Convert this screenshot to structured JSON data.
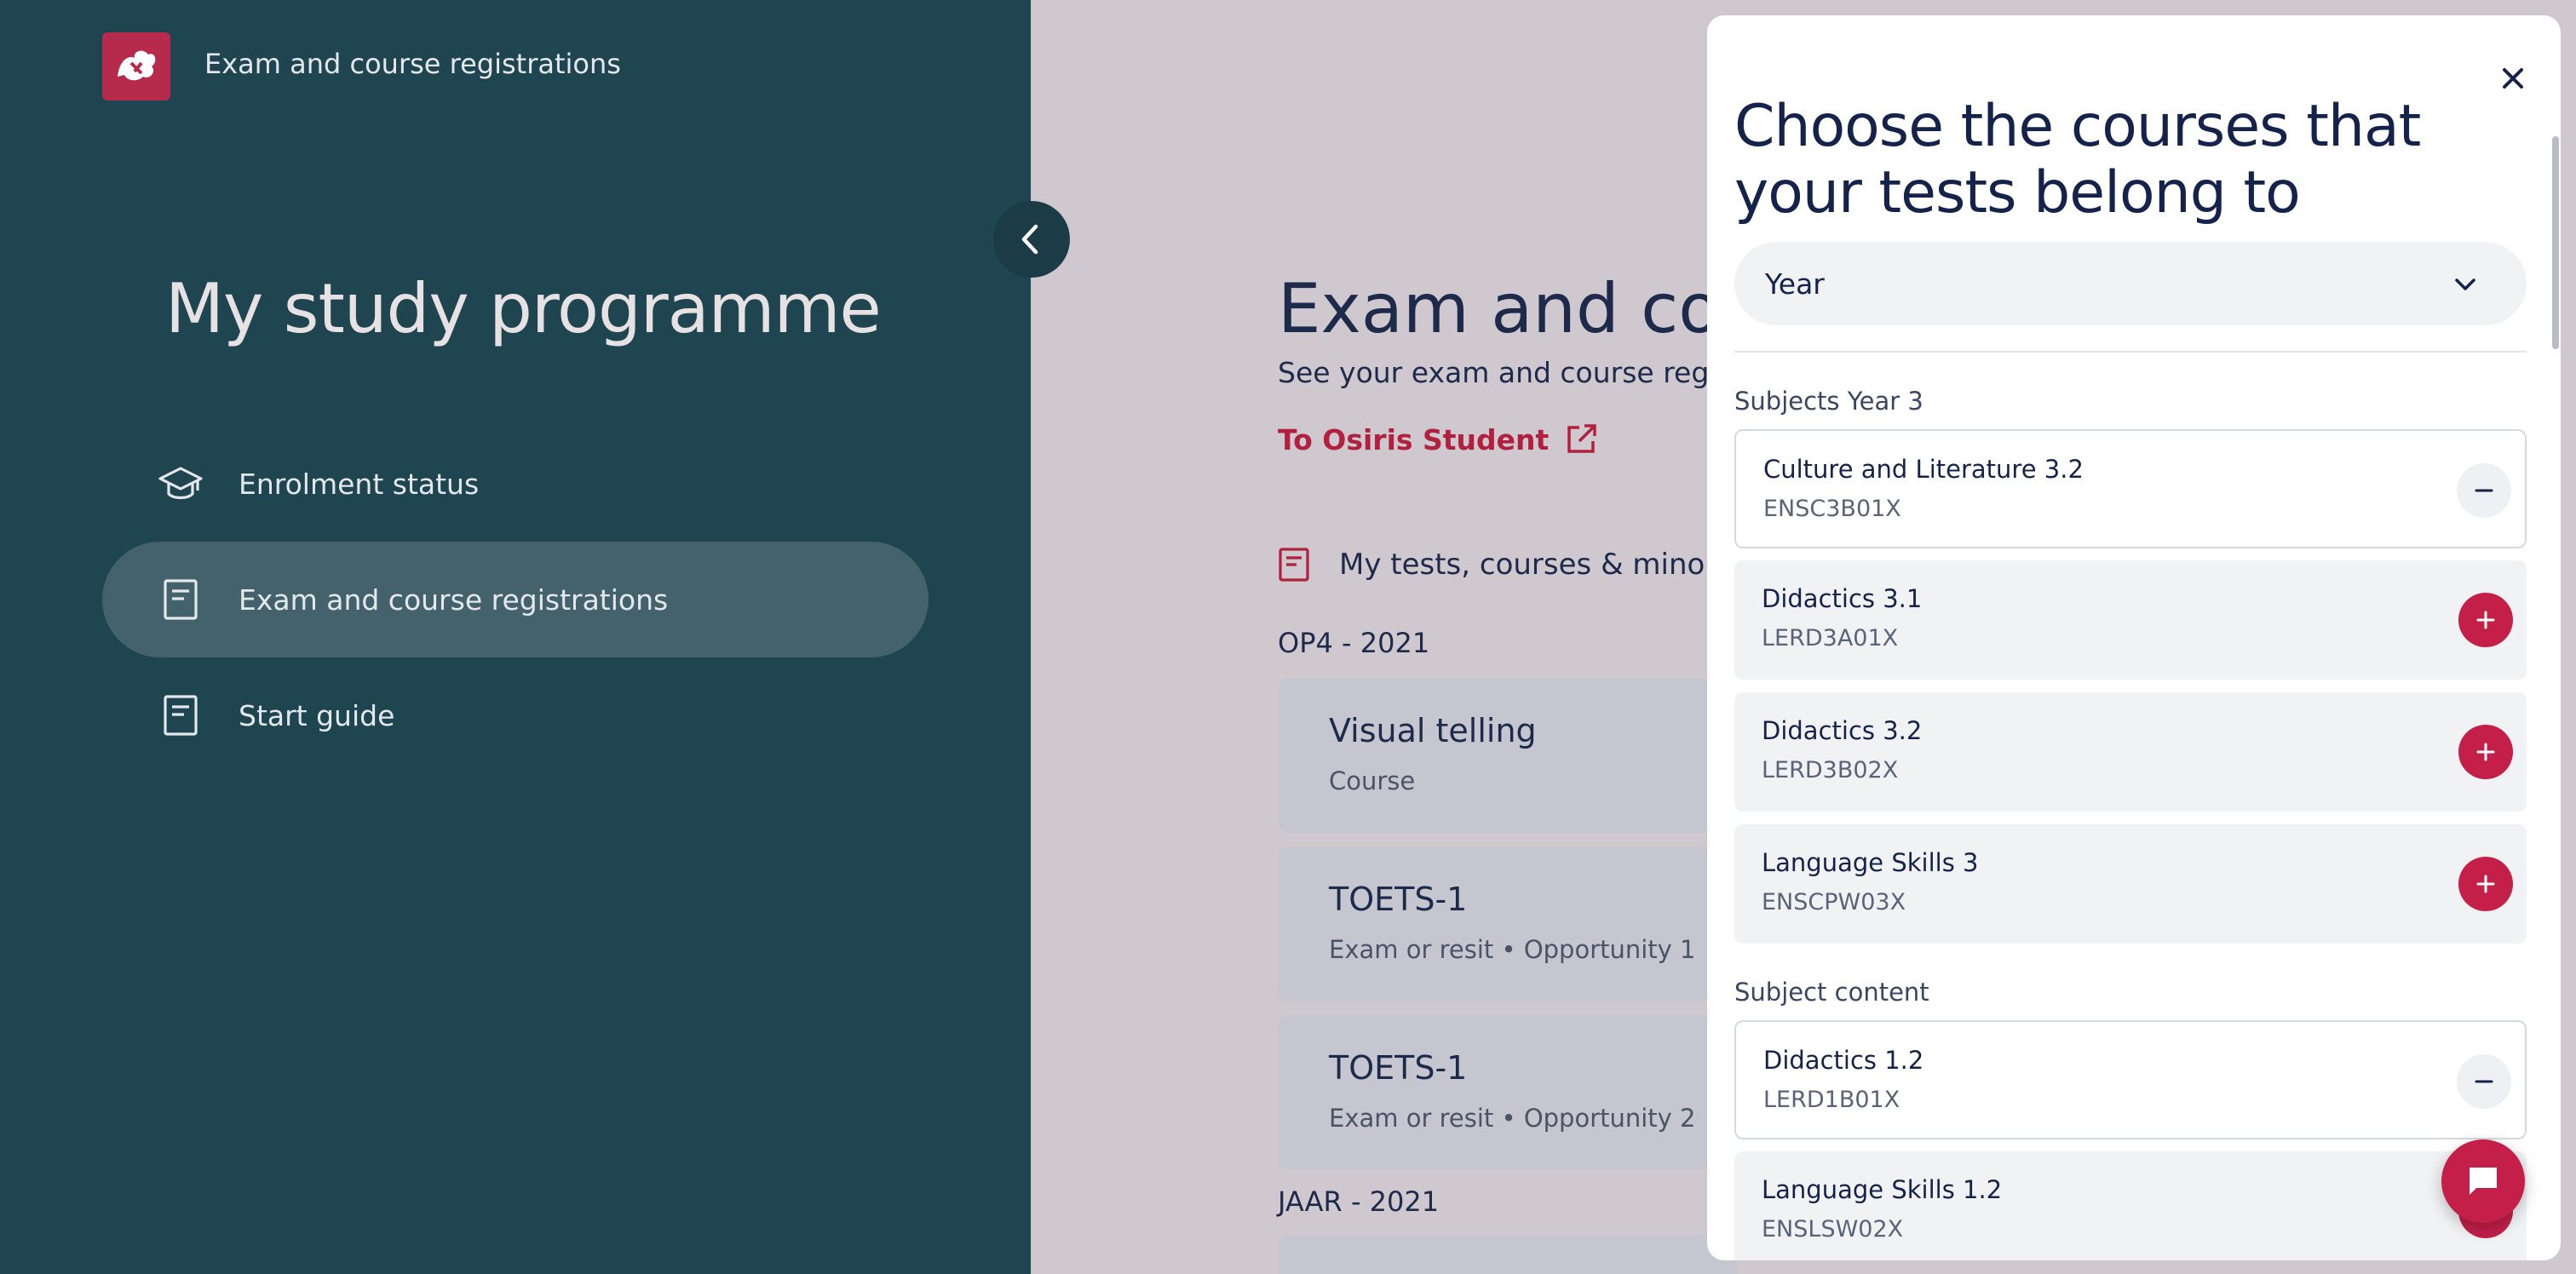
{
  "app": {
    "title": "Exam and course registrations"
  },
  "sidebar": {
    "heading": "My study programme",
    "items": [
      {
        "label": "Enrolment status",
        "icon": "graduation-cap-icon",
        "active": false
      },
      {
        "label": "Exam and course registrations",
        "icon": "document-icon",
        "active": true
      },
      {
        "label": "Start guide",
        "icon": "document-icon",
        "active": false
      }
    ]
  },
  "main": {
    "heading": "Exam and course registrations",
    "subtitle": "See your exam and course registrations",
    "osiris_link": "To Osiris Student",
    "section_label": "My tests, courses & minors",
    "periods": [
      "OP4 - 2021",
      "JAAR - 2021"
    ],
    "cards": [
      {
        "title": "Visual telling",
        "subtitle": "Course"
      },
      {
        "title": "TOETS-1",
        "subtitle": "Exam or resit • Opportunity 1"
      },
      {
        "title": "TOETS-1",
        "subtitle": "Exam or resit • Opportunity 2"
      }
    ]
  },
  "panel": {
    "title": "Choose the courses that your tests belong to",
    "select_value": "Year",
    "groups": [
      {
        "label": "Subjects Year 3",
        "courses": [
          {
            "name": "Culture and Literature 3.2",
            "code": "ENSC3B01X",
            "selected": true
          },
          {
            "name": "Didactics 3.1",
            "code": "LERD3A01X",
            "selected": false
          },
          {
            "name": "Didactics 3.2",
            "code": "LERD3B02X",
            "selected": false
          },
          {
            "name": "Language Skills 3",
            "code": "ENSCPW03X",
            "selected": false
          }
        ]
      },
      {
        "label": "Subject content",
        "courses": [
          {
            "name": "Didactics 1.2",
            "code": "LERD1B01X",
            "selected": true
          },
          {
            "name": "Language Skills 1.2",
            "code": "ENSLSW02X",
            "selected": false
          }
        ]
      }
    ]
  },
  "colors": {
    "sidebar": "#1f4550",
    "accent": "#c41f49",
    "text_dark": "#15234a"
  }
}
